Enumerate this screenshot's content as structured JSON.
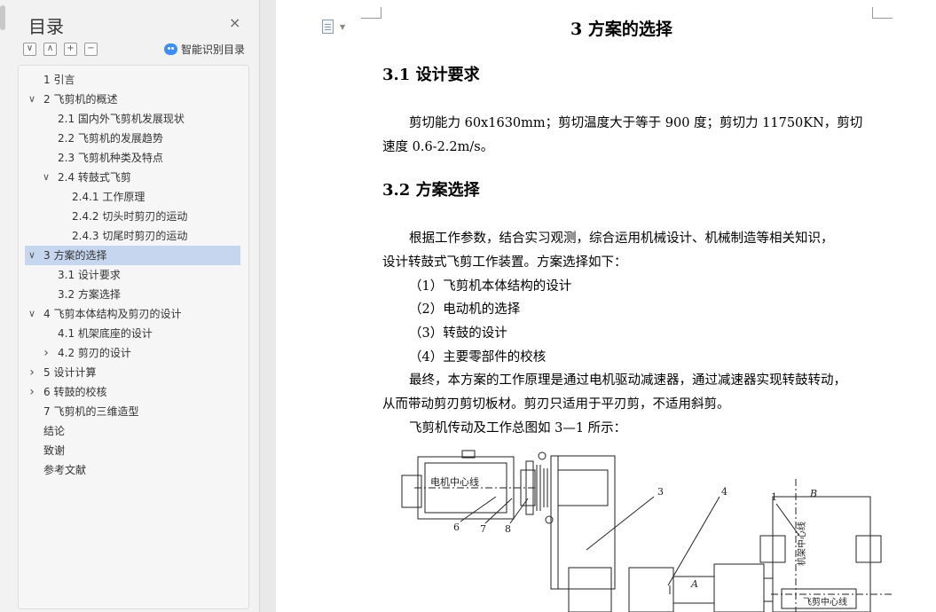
{
  "sidebar": {
    "title": "目录",
    "close_icon": "close-icon",
    "smart_toc_label": "智能识别目录",
    "items": [
      {
        "label": "1 引言",
        "level": 1,
        "expand": "none"
      },
      {
        "label": "2 飞剪机的概述",
        "level": 1,
        "expand": "down"
      },
      {
        "label": "2.1 国内外飞剪机发展现状",
        "level": 2,
        "expand": "none"
      },
      {
        "label": "2.2 飞剪机的发展趋势",
        "level": 2,
        "expand": "none"
      },
      {
        "label": "2.3 飞剪机种类及特点",
        "level": 2,
        "expand": "none"
      },
      {
        "label": "2.4  转鼓式飞剪",
        "level": 2,
        "expand": "down"
      },
      {
        "label": "2.4.1 工作原理",
        "level": 3,
        "expand": "none"
      },
      {
        "label": "2.4.2  切头时剪刃的运动",
        "level": 3,
        "expand": "none"
      },
      {
        "label": "2.4.3  切尾时剪刃的运动",
        "level": 3,
        "expand": "none"
      },
      {
        "label": "3  方案的选择",
        "level": 1,
        "expand": "down",
        "active": true
      },
      {
        "label": "3.1  设计要求",
        "level": 2,
        "expand": "none"
      },
      {
        "label": "3.2  方案选择",
        "level": 2,
        "expand": "none"
      },
      {
        "label": "4 飞剪本体结构及剪刃的设计",
        "level": 1,
        "expand": "down"
      },
      {
        "label": "4.1 机架底座的设计",
        "level": 2,
        "expand": "none"
      },
      {
        "label": "4.2 剪刃的设计",
        "level": 2,
        "expand": "right"
      },
      {
        "label": "5  设计计算",
        "level": 1,
        "expand": "right"
      },
      {
        "label": "6  转鼓的校核",
        "level": 1,
        "expand": "right"
      },
      {
        "label": "7 飞剪机的三维造型",
        "level": 1,
        "expand": "none"
      },
      {
        "label": "结论",
        "level": 1,
        "expand": "none"
      },
      {
        "label": "致谢",
        "level": 1,
        "expand": "none"
      },
      {
        "label": "参考文献",
        "level": 1,
        "expand": "none"
      }
    ]
  },
  "document": {
    "chapter_title": "3  方案的选择",
    "sec1_title": "3.1  设计要求",
    "sec1_para_line1": "剪切能力 60x1630mm；剪切温度大于等于 900 度；剪切力 11750KN，剪切",
    "sec1_para_line2": "速度 0.6-2.2m/s。",
    "sec2_title": "3.2  方案选择",
    "sec2_para_line1": "根据工作参数，结合实习观测，综合运用机械设计、机械制造等相关知识，",
    "sec2_para_line2": "设计转鼓式飞剪工作装置。方案选择如下：",
    "list": [
      "（1）飞剪机本体结构的设计",
      "（2）电动机的选择",
      "（3）转鼓的设计",
      "（4）主要零部件的校核"
    ],
    "final_line1": "最终，本方案的工作原理是通过电机驱动减速器，通过减速器实现转鼓转动，",
    "final_line2": "从而带动剪刃剪切板材。剪刃只适用于平刃剪，不适用斜剪。",
    "figure_intro": "飞剪机传动及工作总图如 3—1 所示："
  },
  "figure": {
    "motor_label": "电机中心线",
    "frame_label": "机架中心线",
    "shear_label": "飞剪中心线",
    "part_numbers": [
      "6",
      "7",
      "8",
      "3",
      "4",
      "1"
    ],
    "arrow_a": "A",
    "arrow_b": "B"
  }
}
